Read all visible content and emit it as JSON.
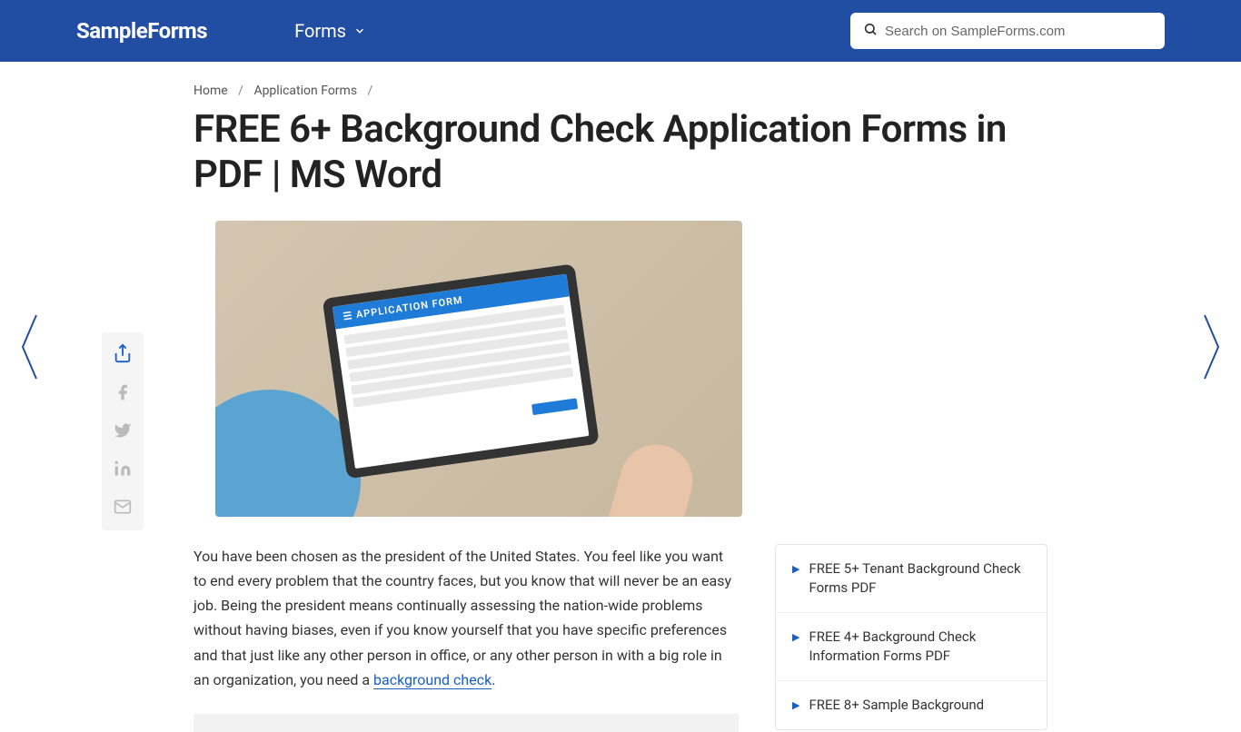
{
  "header": {
    "logo": "SampleForms",
    "nav_forms": "Forms",
    "search_placeholder": "Search on SampleForms.com"
  },
  "breadcrumb": {
    "home": "Home",
    "category": "Application Forms"
  },
  "page": {
    "title": "FREE 6+ Background Check Application Forms in PDF | MS Word"
  },
  "hero": {
    "tablet_header": "☰ APPLICATION FORM"
  },
  "intro": {
    "text_before": "You have been chosen as the president of the United States. You feel like you want to end every problem that the country faces, but you know that will never be an easy job. Being the president means continually assessing the nation-wide problems without having biases, even if you know yourself that you have specific preferences and that just like any other person in office, or any other person in with a big role in an organization, you need a ",
    "link_text": "background check",
    "text_after": "."
  },
  "related": [
    "FREE 5+ Tenant Background Check Forms PDF",
    "FREE 4+ Background Check Information Forms PDF",
    "FREE 8+ Sample Background"
  ]
}
